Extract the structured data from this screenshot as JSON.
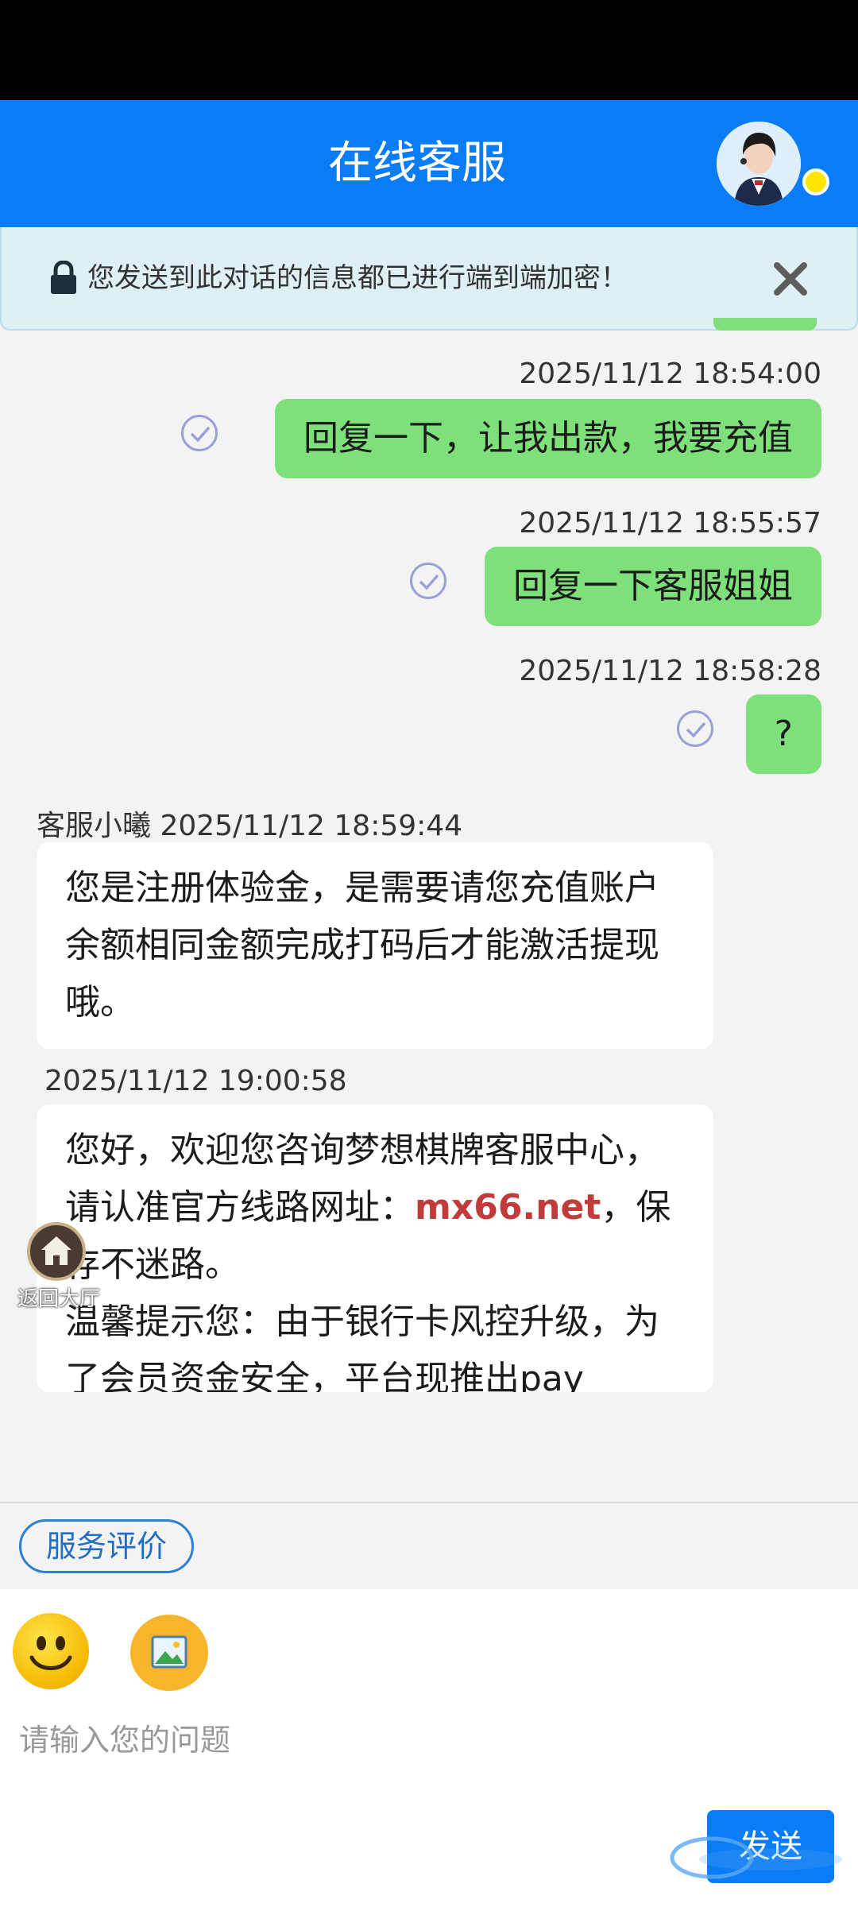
{
  "header": {
    "title": "在线客服"
  },
  "notice": {
    "text": "您发送到此对话的信息都已进行端到端加密！",
    "close": "✕"
  },
  "messages_out": [
    {
      "time": "2025/11/12 18:54:00",
      "text": "回复一下，让我出款，我要充值"
    },
    {
      "time": "2025/11/12 18:55:57",
      "text": "回复一下客服姐姐"
    },
    {
      "time": "2025/11/12 18:58:28",
      "text": "?"
    }
  ],
  "messages_in": [
    {
      "sender": "客服小曦",
      "time": "2025/11/12 18:59:44",
      "text": "您是注册体验金，是需要请您充值账户余额相同金额完成打码后才能激活提现哦。"
    },
    {
      "time": "2025/11/12 19:00:58",
      "part1": "您好，欢迎您咨询梦想棋牌客服中心，请认准官方线路网址：",
      "link": "mx66.net",
      "part2": "，保存不迷路。",
      "part3": "温馨提示您：由于银行卡风控升级，为了会员资金安全，平台现推出pay"
    }
  ],
  "floating": {
    "home_label": "返回大厅"
  },
  "rating": {
    "label": "服务评价"
  },
  "input": {
    "placeholder": "请输入您的问题"
  },
  "send": {
    "label": "发送"
  },
  "colors": {
    "header": "#0a7cf5",
    "bubble_out": "#7ee07a",
    "link": "#c23b3b"
  }
}
